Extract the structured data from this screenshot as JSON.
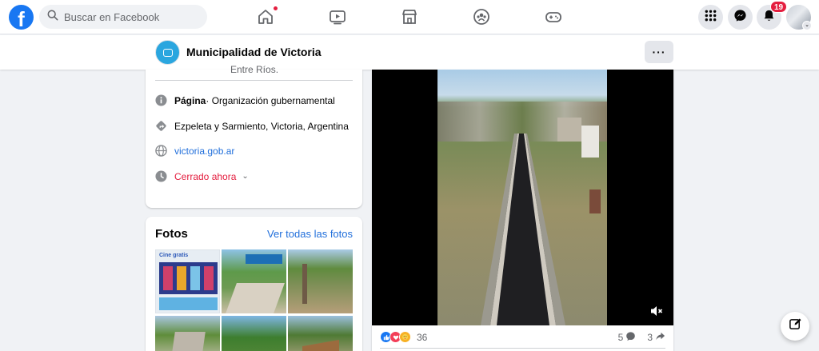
{
  "topbar": {
    "logo": "f",
    "search_placeholder": "Buscar en Facebook",
    "nav_icons": [
      "home-icon",
      "watch-icon",
      "marketplace-icon",
      "groups-icon",
      "gaming-icon"
    ],
    "notifications_count": "19"
  },
  "page_header": {
    "name": "Municipalidad de Victoria",
    "more_label": "···"
  },
  "intro": {
    "cut_text": "Entre Ríos.",
    "category_bold": "Página",
    "category_rest": " · Organización gubernamental",
    "address": "Ezpeleta y Sarmiento, Victoria, Argentina",
    "website": "victoria.gob.ar",
    "hours_status": "Cerrado ahora",
    "hours_chevron": "⌄"
  },
  "photos": {
    "title": "Fotos",
    "see_all": "Ver todas las fotos",
    "poster_text": "Cine gratis"
  },
  "post": {
    "reaction_count": "36",
    "comments_count": "5",
    "shares_count": "3"
  },
  "colors": {
    "brand": "#1877f2",
    "link": "#216fdb",
    "closed": "#e41e3f",
    "badge": "#e41e3f"
  }
}
